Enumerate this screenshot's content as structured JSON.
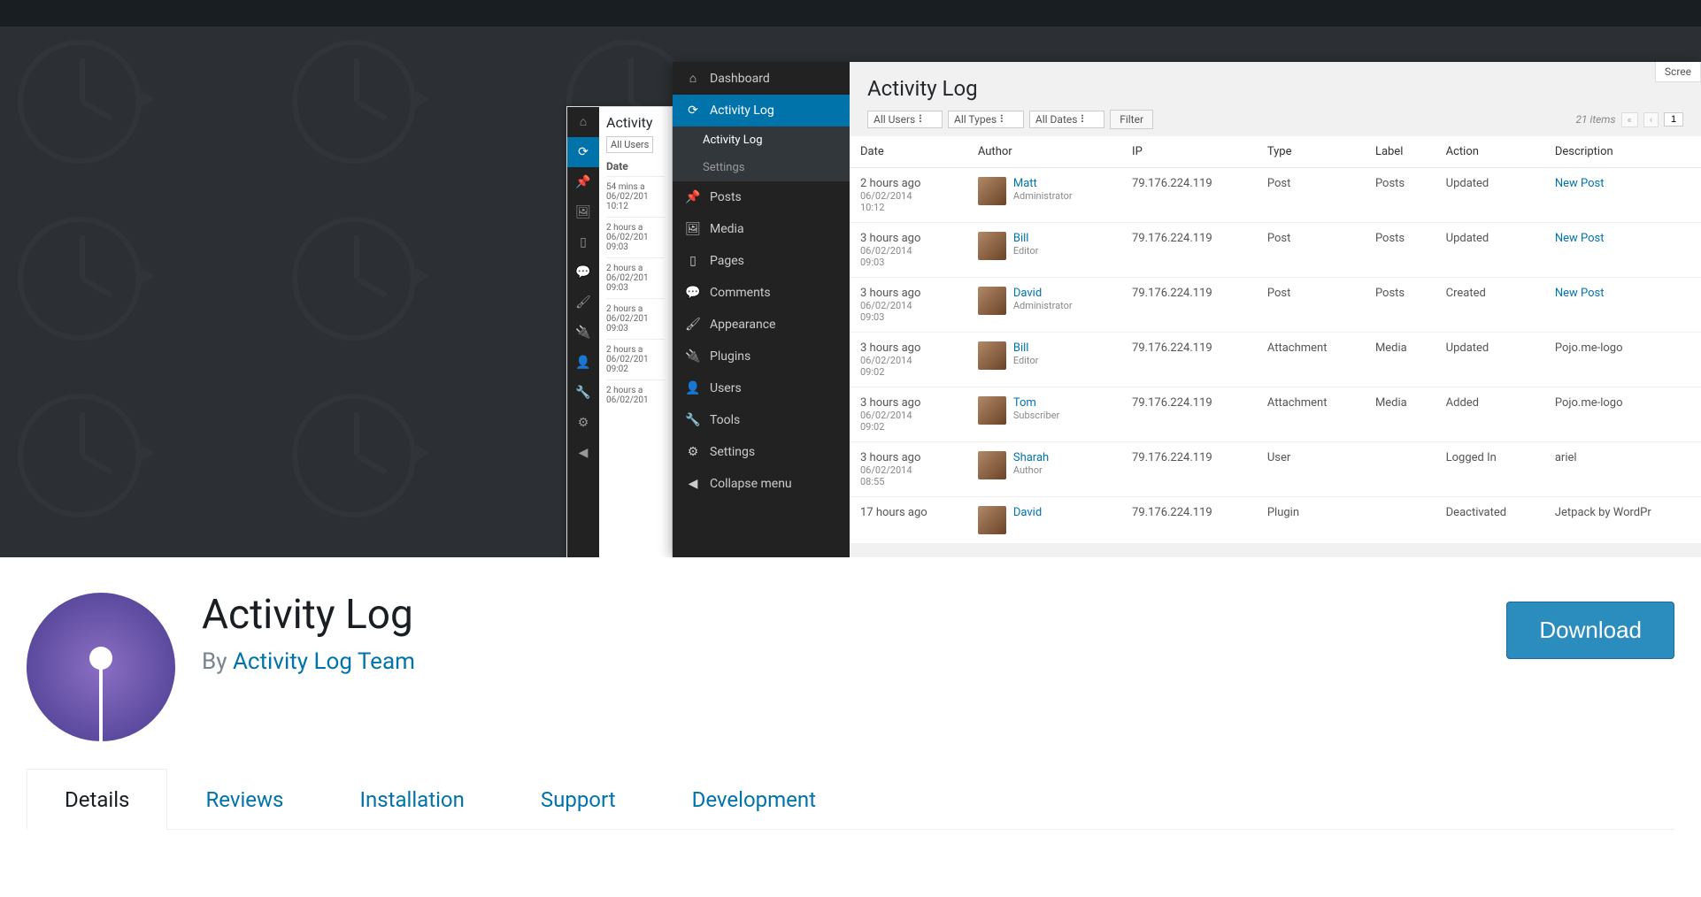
{
  "banner": {
    "back_window": {
      "title": "Activity",
      "filter_users": "All Users",
      "col_date": "Date",
      "rows": [
        {
          "rel": "54 mins a",
          "date": "06/02/201",
          "time": "10:12"
        },
        {
          "rel": "2 hours a",
          "date": "06/02/201",
          "time": "09:03"
        },
        {
          "rel": "2 hours a",
          "date": "06/02/201",
          "time": "09:03"
        },
        {
          "rel": "2 hours a",
          "date": "06/02/201",
          "time": "09:03"
        },
        {
          "rel": "2 hours a",
          "date": "06/02/201",
          "time": "09:02"
        },
        {
          "rel": "2 hours a",
          "date": "06/02/201",
          "time": ""
        }
      ]
    },
    "sidebar": [
      {
        "icon": "⌂",
        "label": "Dashboard",
        "kind": "item"
      },
      {
        "icon": "⟳",
        "label": "Activity Log",
        "kind": "active"
      },
      {
        "icon": "",
        "label": "Activity Log",
        "kind": "sub-first"
      },
      {
        "icon": "",
        "label": "Settings",
        "kind": "sub-second"
      },
      {
        "icon": "📌",
        "label": "Posts",
        "kind": "item"
      },
      {
        "icon": "🖼",
        "label": "Media",
        "kind": "item"
      },
      {
        "icon": "▯",
        "label": "Pages",
        "kind": "item"
      },
      {
        "icon": "💬",
        "label": "Comments",
        "kind": "item"
      },
      {
        "icon": "🖌",
        "label": "Appearance",
        "kind": "item"
      },
      {
        "icon": "🔌",
        "label": "Plugins",
        "kind": "item"
      },
      {
        "icon": "👤",
        "label": "Users",
        "kind": "item"
      },
      {
        "icon": "🔧",
        "label": "Tools",
        "kind": "item"
      },
      {
        "icon": "⚙",
        "label": "Settings",
        "kind": "item"
      },
      {
        "icon": "◀",
        "label": "Collapse menu",
        "kind": "item"
      }
    ],
    "main": {
      "title": "Activity Log",
      "screen_options": "Scree",
      "filters": {
        "users": "All Users",
        "types": "All Types",
        "dates": "All Dates",
        "button": "Filter",
        "items_count": "21 items",
        "page": "1"
      },
      "columns": [
        "Date",
        "Author",
        "IP",
        "Type",
        "Label",
        "Action",
        "Description"
      ],
      "rows": [
        {
          "rel": "2 hours ago",
          "date": "06/02/2014",
          "time": "10:12",
          "author": "Matt",
          "role": "Administrator",
          "ip": "79.176.224.119",
          "type": "Post",
          "label": "Posts",
          "action": "Updated",
          "desc": "New Post",
          "desc_link": true
        },
        {
          "rel": "3 hours ago",
          "date": "06/02/2014",
          "time": "09:03",
          "author": "Bill",
          "role": "Editor",
          "ip": "79.176.224.119",
          "type": "Post",
          "label": "Posts",
          "action": "Updated",
          "desc": "New Post",
          "desc_link": true
        },
        {
          "rel": "3 hours ago",
          "date": "06/02/2014",
          "time": "09:03",
          "author": "David",
          "role": "Administrator",
          "ip": "79.176.224.119",
          "type": "Post",
          "label": "Posts",
          "action": "Created",
          "desc": "New Post",
          "desc_link": true
        },
        {
          "rel": "3 hours ago",
          "date": "06/02/2014",
          "time": "09:02",
          "author": "Bill",
          "role": "Editor",
          "ip": "79.176.224.119",
          "type": "Attachment",
          "label": "Media",
          "action": "Updated",
          "desc": "Pojo.me-logo",
          "desc_link": false
        },
        {
          "rel": "3 hours ago",
          "date": "06/02/2014",
          "time": "09:02",
          "author": "Tom",
          "role": "Subscriber",
          "ip": "79.176.224.119",
          "type": "Attachment",
          "label": "Media",
          "action": "Added",
          "desc": "Pojo.me-logo",
          "desc_link": false
        },
        {
          "rel": "3 hours ago",
          "date": "06/02/2014",
          "time": "08:55",
          "author": "Sharah",
          "role": "Author",
          "ip": "79.176.224.119",
          "type": "User",
          "label": "",
          "action": "Logged In",
          "desc": "ariel",
          "desc_link": false
        },
        {
          "rel": "17 hours ago",
          "date": "",
          "time": "",
          "author": "David",
          "role": "",
          "ip": "79.176.224.119",
          "type": "Plugin",
          "label": "",
          "action": "Deactivated",
          "desc": "Jetpack by WordPr",
          "desc_link": false
        }
      ]
    }
  },
  "plugin": {
    "name": "Activity Log",
    "by_prefix": "By ",
    "author": "Activity Log Team",
    "download": "Download"
  },
  "tabs": [
    "Details",
    "Reviews",
    "Installation",
    "Support",
    "Development"
  ]
}
